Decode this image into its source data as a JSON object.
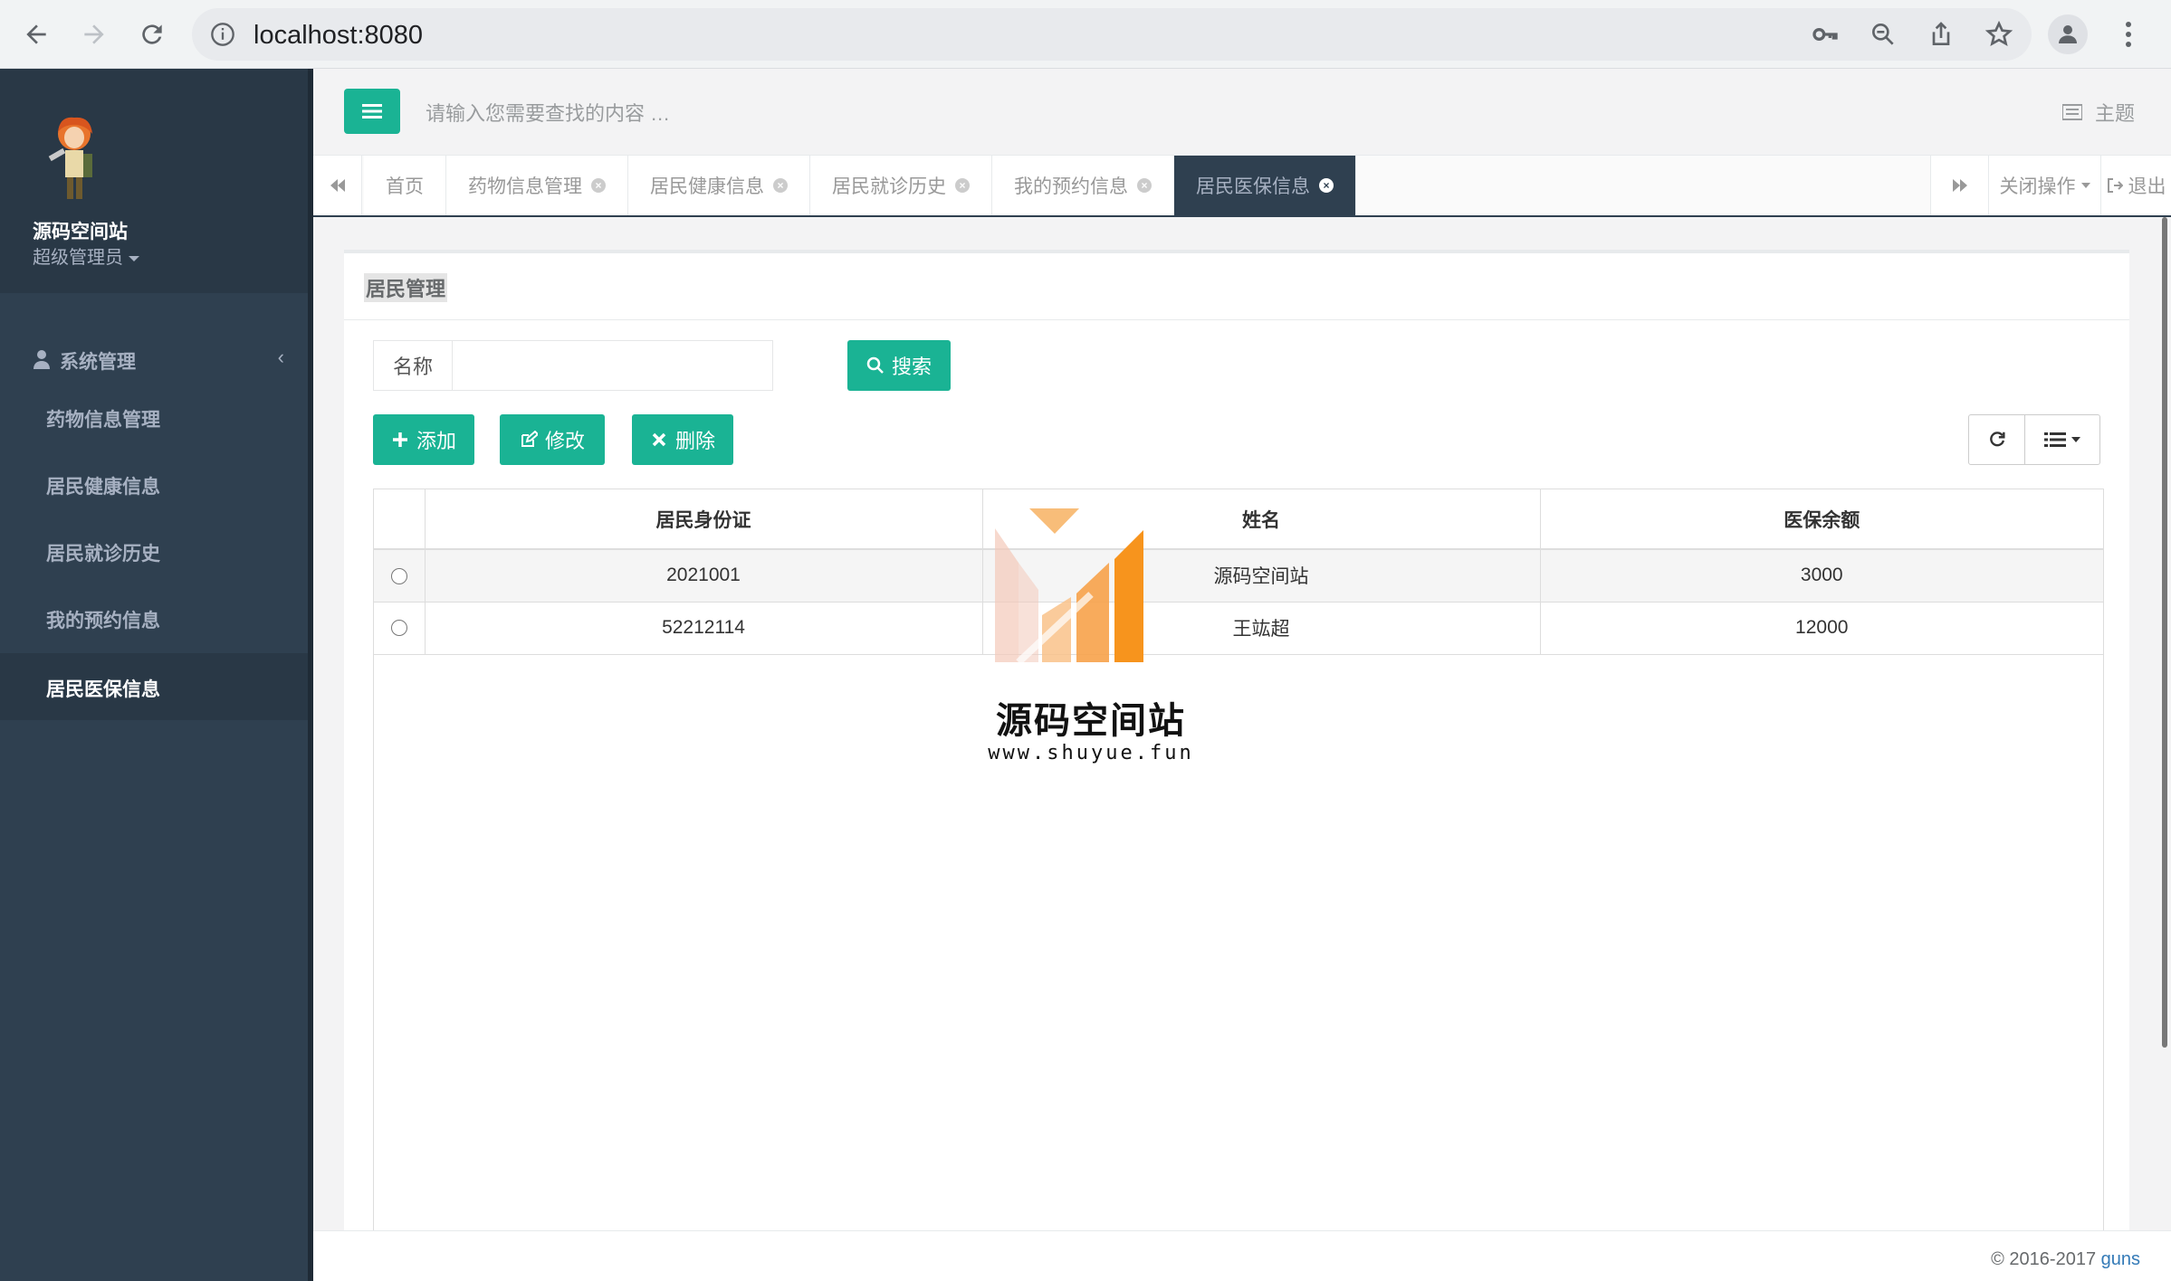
{
  "browser": {
    "url": "localhost:8080"
  },
  "sidebar": {
    "profile_name": "源码空间站",
    "profile_role": "超级管理员",
    "group_label": "系统管理",
    "items": [
      {
        "label": "药物信息管理"
      },
      {
        "label": "居民健康信息"
      },
      {
        "label": "居民就诊历史"
      },
      {
        "label": "我的预约信息"
      },
      {
        "label": "居民医保信息"
      }
    ]
  },
  "topbar": {
    "search_placeholder": "请输入您需要查找的内容 …",
    "theme_label": "主题"
  },
  "tabs": {
    "items": [
      {
        "label": "首页"
      },
      {
        "label": "药物信息管理"
      },
      {
        "label": "居民健康信息"
      },
      {
        "label": "居民就诊历史"
      },
      {
        "label": "我的预约信息"
      },
      {
        "label": "居民医保信息"
      }
    ],
    "close_ops_label": "关闭操作",
    "logout_label": "退出"
  },
  "panel": {
    "title": "居民管理",
    "search_label": "名称",
    "search_value": "",
    "search_button": "搜索",
    "add_button": "添加",
    "edit_button": "修改",
    "delete_button": "删除"
  },
  "table": {
    "columns": [
      "居民身份证",
      "姓名",
      "医保余额"
    ],
    "rows": [
      {
        "id": "2021001",
        "name": "源码空间站",
        "balance": "3000"
      },
      {
        "id": "52212114",
        "name": "王竑超",
        "balance": "12000"
      }
    ]
  },
  "watermark": {
    "title": "源码空间站",
    "url": "www.shuyue.fun"
  },
  "footer": {
    "copyright": "© 2016-2017",
    "link": "guns"
  },
  "colors": {
    "sidebar_bg": "#2f4050",
    "accent": "#1ab394",
    "watermark_orange": "#f7941d"
  }
}
